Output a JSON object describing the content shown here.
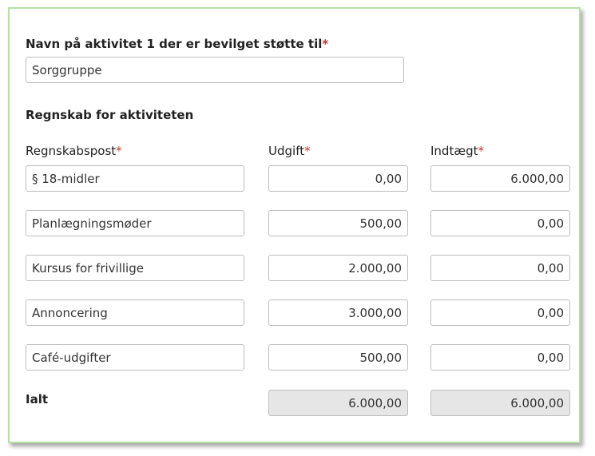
{
  "activity": {
    "label": "Navn på aktivitet 1 der er bevilget støtte til",
    "required_mark": "*",
    "value": "Sorggruppe"
  },
  "section_title": "Regnskab for aktiviteten",
  "columns": {
    "post": "Regnskabspost",
    "expense": "Udgift",
    "income": "Indtægt",
    "required_mark": "*"
  },
  "rows": [
    {
      "post": "§ 18-midler",
      "expense": "0,00",
      "income": "6.000,00"
    },
    {
      "post": "Planlægningsmøder",
      "expense": "500,00",
      "income": "0,00"
    },
    {
      "post": "Kursus for frivillige",
      "expense": "2.000,00",
      "income": "0,00"
    },
    {
      "post": "Annoncering",
      "expense": "3.000,00",
      "income": "0,00"
    },
    {
      "post": "Café-udgifter",
      "expense": "500,00",
      "income": "0,00"
    }
  ],
  "totals": {
    "label": "Ialt",
    "expense": "6.000,00",
    "income": "6.000,00"
  }
}
